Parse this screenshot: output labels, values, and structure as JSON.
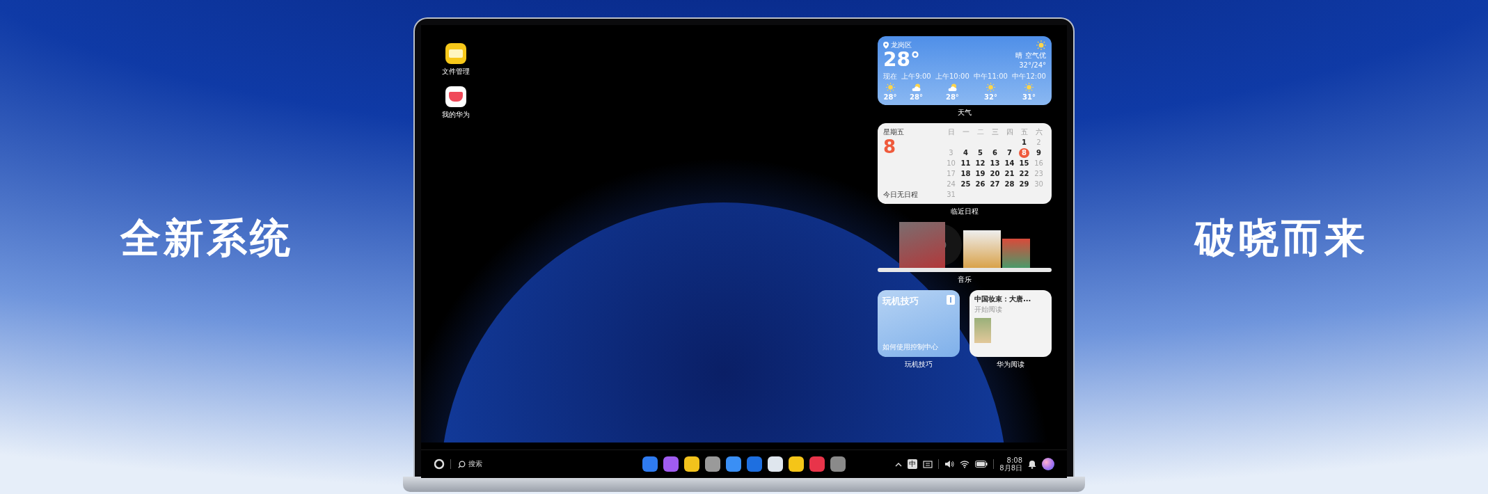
{
  "headline_left": "全新系统",
  "headline_right": "破晓而来",
  "desktop_icons": [
    {
      "kind": "files",
      "label": "文件管理"
    },
    {
      "kind": "myhuawei",
      "label": "我的华为"
    }
  ],
  "weather": {
    "location": "龙岗区",
    "temperature": "28°",
    "condition": "晴",
    "air": "空气优",
    "range": "32°/24°",
    "hourly": [
      {
        "time": "现在",
        "kind": "sunny",
        "temp": "28°"
      },
      {
        "time": "上午9:00",
        "kind": "cloudy",
        "temp": "28°"
      },
      {
        "time": "上午10:00",
        "kind": "cloudy",
        "temp": "28°"
      },
      {
        "time": "中午11:00",
        "kind": "sunny",
        "temp": "32°"
      },
      {
        "time": "中午12:00",
        "kind": "sunny",
        "temp": "31°"
      }
    ],
    "label": "天气"
  },
  "calendar": {
    "weekday": "星期五",
    "day": "8",
    "note": "今日无日程",
    "label": "临近日程",
    "headers": [
      "日",
      "一",
      "二",
      "三",
      "四",
      "五",
      "六"
    ],
    "weeks": [
      {
        "kind": "first",
        "days": [
          {
            "day": "1",
            "muted": false,
            "selected": false
          },
          {
            "day": "2",
            "muted": true,
            "selected": false
          }
        ]
      },
      {
        "kind": "full",
        "days": [
          {
            "day": "3",
            "muted": true,
            "selected": false
          },
          {
            "day": "4",
            "muted": false,
            "selected": false
          },
          {
            "day": "5",
            "muted": false,
            "selected": false
          },
          {
            "day": "6",
            "muted": false,
            "selected": false
          },
          {
            "day": "7",
            "muted": false,
            "selected": false
          },
          {
            "day": "8",
            "muted": false,
            "selected": true
          },
          {
            "day": "9",
            "muted": false,
            "selected": false
          }
        ]
      },
      {
        "kind": "full",
        "days": [
          {
            "day": "10",
            "muted": true,
            "selected": false
          },
          {
            "day": "11",
            "muted": false,
            "selected": false
          },
          {
            "day": "12",
            "muted": false,
            "selected": false
          },
          {
            "day": "13",
            "muted": false,
            "selected": false
          },
          {
            "day": "14",
            "muted": false,
            "selected": false
          },
          {
            "day": "15",
            "muted": false,
            "selected": false
          },
          {
            "day": "16",
            "muted": true,
            "selected": false
          }
        ]
      },
      {
        "kind": "full",
        "days": [
          {
            "day": "17",
            "muted": true,
            "selected": false
          },
          {
            "day": "18",
            "muted": false,
            "selected": false
          },
          {
            "day": "19",
            "muted": false,
            "selected": false
          },
          {
            "day": "20",
            "muted": false,
            "selected": false
          },
          {
            "day": "21",
            "muted": false,
            "selected": false
          },
          {
            "day": "22",
            "muted": false,
            "selected": false
          },
          {
            "day": "23",
            "muted": true,
            "selected": false
          }
        ]
      },
      {
        "kind": "full",
        "days": [
          {
            "day": "24",
            "muted": true,
            "selected": false
          },
          {
            "day": "25",
            "muted": false,
            "selected": false
          },
          {
            "day": "26",
            "muted": false,
            "selected": false
          },
          {
            "day": "27",
            "muted": false,
            "selected": false
          },
          {
            "day": "28",
            "muted": false,
            "selected": false
          },
          {
            "day": "29",
            "muted": false,
            "selected": false
          },
          {
            "day": "30",
            "muted": true,
            "selected": false
          }
        ]
      },
      {
        "kind": "last",
        "days": [
          {
            "day": "31",
            "muted": true,
            "selected": false
          }
        ]
      }
    ]
  },
  "music": {
    "label": "音乐"
  },
  "tips": {
    "title": "玩机技巧",
    "subtitle": "如何使用控制中心",
    "label": "玩机技巧"
  },
  "reading": {
    "title": "中国妆束：大唐...",
    "subtitle": "开始阅读",
    "label": "华为阅读"
  },
  "taskbar": {
    "search": "搜索",
    "ime": "中",
    "time": "8:08",
    "date": "8月8日"
  }
}
